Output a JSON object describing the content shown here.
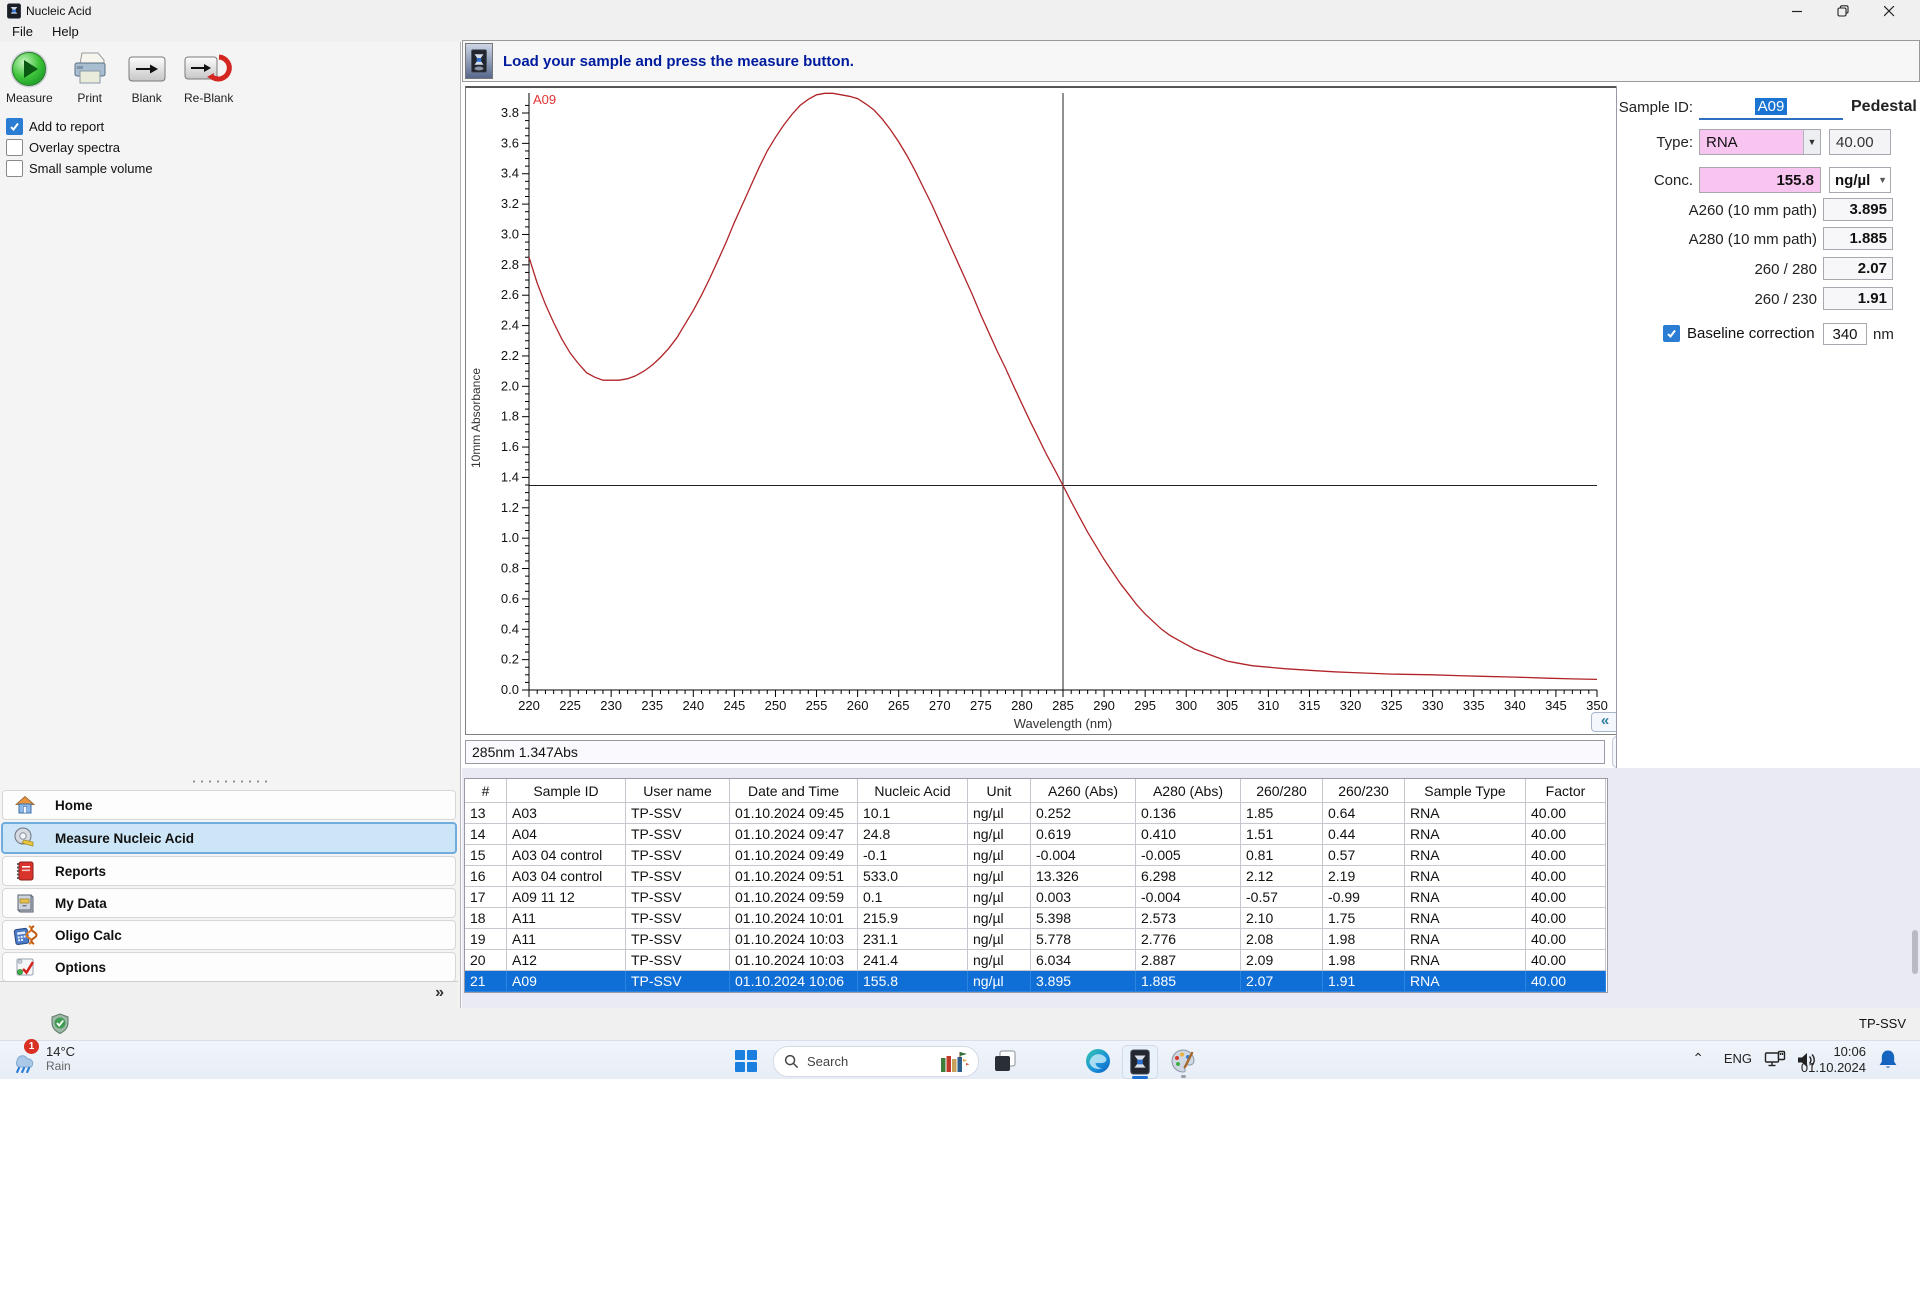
{
  "window": {
    "title": "Nucleic Acid",
    "menu": [
      {
        "label": "File"
      },
      {
        "label": "Help"
      }
    ]
  },
  "toolbar": {
    "buttons": [
      {
        "label": "Measure",
        "icon": "measure-play-icon"
      },
      {
        "label": "Print",
        "icon": "printer-icon"
      },
      {
        "label": "Blank",
        "icon": "blank-arrow-icon"
      },
      {
        "label": "Re-Blank",
        "icon": "reblank-arrow-icon"
      }
    ]
  },
  "options": [
    {
      "label": "Add to report",
      "checked": true
    },
    {
      "label": "Overlay spectra",
      "checked": false
    },
    {
      "label": "Small sample volume",
      "checked": false
    }
  ],
  "message": "Load your sample and press the measure button.",
  "cursor_readout": "285nm 1.347Abs",
  "chart_data": {
    "type": "line",
    "title": "",
    "xlabel": "Wavelength (nm)",
    "ylabel": "10mm Absorbance",
    "xlim": [
      220,
      350
    ],
    "ylim": [
      0,
      3.9
    ],
    "xtick_major": 5,
    "xtick_minor": 1,
    "ytick_major": 0.2,
    "ytick_minor": 0.05,
    "grid": false,
    "legend_position": "top-left-inside",
    "crosshair": {
      "x": 285,
      "y": 1.347
    },
    "series": [
      {
        "name": "A09",
        "color": "#b02428",
        "legend_color": "#e23333",
        "points": [
          [
            220,
            2.85
          ],
          [
            221,
            2.68
          ],
          [
            222,
            2.54
          ],
          [
            223,
            2.42
          ],
          [
            224,
            2.31
          ],
          [
            225,
            2.22
          ],
          [
            226,
            2.15
          ],
          [
            227,
            2.09
          ],
          [
            228,
            2.06
          ],
          [
            229,
            2.04
          ],
          [
            230,
            2.04
          ],
          [
            231,
            2.04
          ],
          [
            232,
            2.05
          ],
          [
            233,
            2.07
          ],
          [
            234,
            2.1
          ],
          [
            235,
            2.14
          ],
          [
            236,
            2.19
          ],
          [
            237,
            2.25
          ],
          [
            238,
            2.32
          ],
          [
            239,
            2.41
          ],
          [
            240,
            2.5
          ],
          [
            241,
            2.6
          ],
          [
            242,
            2.71
          ],
          [
            243,
            2.83
          ],
          [
            244,
            2.95
          ],
          [
            245,
            3.08
          ],
          [
            246,
            3.2
          ],
          [
            247,
            3.32
          ],
          [
            248,
            3.44
          ],
          [
            249,
            3.55
          ],
          [
            250,
            3.64
          ],
          [
            251,
            3.72
          ],
          [
            252,
            3.79
          ],
          [
            253,
            3.85
          ],
          [
            254,
            3.89
          ],
          [
            255,
            3.92
          ],
          [
            256,
            3.93
          ],
          [
            257,
            3.93
          ],
          [
            258,
            3.92
          ],
          [
            259,
            3.91
          ],
          [
            260,
            3.895
          ],
          [
            261,
            3.86
          ],
          [
            262,
            3.82
          ],
          [
            263,
            3.76
          ],
          [
            264,
            3.69
          ],
          [
            265,
            3.61
          ],
          [
            266,
            3.52
          ],
          [
            267,
            3.42
          ],
          [
            268,
            3.31
          ],
          [
            269,
            3.2
          ],
          [
            270,
            3.08
          ],
          [
            271,
            2.96
          ],
          [
            272,
            2.84
          ],
          [
            273,
            2.72
          ],
          [
            274,
            2.6
          ],
          [
            275,
            2.47
          ],
          [
            276,
            2.35
          ],
          [
            277,
            2.23
          ],
          [
            278,
            2.12
          ],
          [
            279,
            2.0
          ],
          [
            280,
            1.885
          ],
          [
            281,
            1.77
          ],
          [
            282,
            1.66
          ],
          [
            283,
            1.55
          ],
          [
            284,
            1.45
          ],
          [
            285,
            1.347
          ],
          [
            286,
            1.24
          ],
          [
            287,
            1.14
          ],
          [
            288,
            1.04
          ],
          [
            289,
            0.95
          ],
          [
            290,
            0.86
          ],
          [
            291,
            0.78
          ],
          [
            292,
            0.7
          ],
          [
            293,
            0.63
          ],
          [
            294,
            0.56
          ],
          [
            295,
            0.5
          ],
          [
            296,
            0.45
          ],
          [
            297,
            0.4
          ],
          [
            298,
            0.36
          ],
          [
            299,
            0.33
          ],
          [
            300,
            0.3
          ],
          [
            301,
            0.27
          ],
          [
            302,
            0.25
          ],
          [
            303,
            0.23
          ],
          [
            304,
            0.21
          ],
          [
            305,
            0.19
          ],
          [
            306,
            0.18
          ],
          [
            307,
            0.17
          ],
          [
            308,
            0.16
          ],
          [
            310,
            0.15
          ],
          [
            312,
            0.14
          ],
          [
            315,
            0.13
          ],
          [
            318,
            0.12
          ],
          [
            320,
            0.115
          ],
          [
            325,
            0.105
          ],
          [
            330,
            0.1
          ],
          [
            333,
            0.095
          ],
          [
            336,
            0.09
          ],
          [
            340,
            0.085
          ],
          [
            344,
            0.078
          ],
          [
            347,
            0.073
          ],
          [
            350,
            0.07
          ]
        ]
      }
    ]
  },
  "side_panel": {
    "sample_id_label": "Sample ID:",
    "sample_id_value": "A09",
    "mode_label": "Pedestal",
    "type_label": "Type:",
    "type_value": "RNA",
    "type_factor": "40.00",
    "conc_label": "Conc.",
    "conc_value": "155.8",
    "conc_unit": "ng/µl",
    "metrics": [
      {
        "label": "A260 (10 mm path)",
        "value": "3.895"
      },
      {
        "label": "A280 (10 mm path)",
        "value": "1.885"
      },
      {
        "label": "260 / 280",
        "value": "2.07"
      },
      {
        "label": "260 / 230",
        "value": "1.91"
      }
    ],
    "baseline": {
      "label": "Baseline correction",
      "checked": true,
      "value": "340",
      "unit": "nm"
    }
  },
  "results_table": {
    "columns": [
      "#",
      "Sample ID",
      "User name",
      "Date and Time",
      "Nucleic Acid",
      "Unit",
      "A260 (Abs)",
      "A280 (Abs)",
      "260/280",
      "260/230",
      "Sample Type",
      "Factor"
    ],
    "selected_row": "21",
    "rows": [
      [
        "13",
        "A03",
        "TP-SSV",
        "01.10.2024 09:45",
        "10.1",
        "ng/µl",
        "0.252",
        "0.136",
        "1.85",
        "0.64",
        "RNA",
        "40.00"
      ],
      [
        "14",
        "A04",
        "TP-SSV",
        "01.10.2024 09:47",
        "24.8",
        "ng/µl",
        "0.619",
        "0.410",
        "1.51",
        "0.44",
        "RNA",
        "40.00"
      ],
      [
        "15",
        "A03 04 control",
        "TP-SSV",
        "01.10.2024 09:49",
        "-0.1",
        "ng/µl",
        "-0.004",
        "-0.005",
        "0.81",
        "0.57",
        "RNA",
        "40.00"
      ],
      [
        "16",
        "A03 04 control",
        "TP-SSV",
        "01.10.2024 09:51",
        "533.0",
        "ng/µl",
        "13.326",
        "6.298",
        "2.12",
        "2.19",
        "RNA",
        "40.00"
      ],
      [
        "17",
        "A09 11 12",
        "TP-SSV",
        "01.10.2024 09:59",
        "0.1",
        "ng/µl",
        "0.003",
        "-0.004",
        "-0.57",
        "-0.99",
        "RNA",
        "40.00"
      ],
      [
        "18",
        "A11",
        "TP-SSV",
        "01.10.2024 10:01",
        "215.9",
        "ng/µl",
        "5.398",
        "2.573",
        "2.10",
        "1.75",
        "RNA",
        "40.00"
      ],
      [
        "19",
        "A11",
        "TP-SSV",
        "01.10.2024 10:03",
        "231.1",
        "ng/µl",
        "5.778",
        "2.776",
        "2.08",
        "1.98",
        "RNA",
        "40.00"
      ],
      [
        "20",
        "A12",
        "TP-SSV",
        "01.10.2024 10:03",
        "241.4",
        "ng/µl",
        "6.034",
        "2.887",
        "2.09",
        "1.98",
        "RNA",
        "40.00"
      ],
      [
        "21",
        "A09",
        "TP-SSV",
        "01.10.2024 10:06",
        "155.8",
        "ng/µl",
        "3.895",
        "1.885",
        "2.07",
        "1.91",
        "RNA",
        "40.00"
      ]
    ]
  },
  "sidebar": {
    "items": [
      {
        "label": "Home",
        "icon": "home-icon",
        "selected": false
      },
      {
        "label": "Measure Nucleic Acid",
        "icon": "measure-tape-icon",
        "selected": true
      },
      {
        "label": "Reports",
        "icon": "report-book-icon",
        "selected": false
      },
      {
        "label": "My Data",
        "icon": "file-cabinet-icon",
        "selected": false
      },
      {
        "label": "Oligo Calc",
        "icon": "calculator-dna-icon",
        "selected": false
      },
      {
        "label": "Options",
        "icon": "options-check-icon",
        "selected": false
      }
    ],
    "expand_label": "»"
  },
  "statusbar": {
    "user": "TP-SSV"
  },
  "taskbar": {
    "weather": {
      "temp": "14°C",
      "condition": "Rain",
      "badge": "1"
    },
    "search_label": "Search",
    "tray": {
      "language": "ENG",
      "time": "10:06",
      "date": "01.10.2024"
    }
  }
}
